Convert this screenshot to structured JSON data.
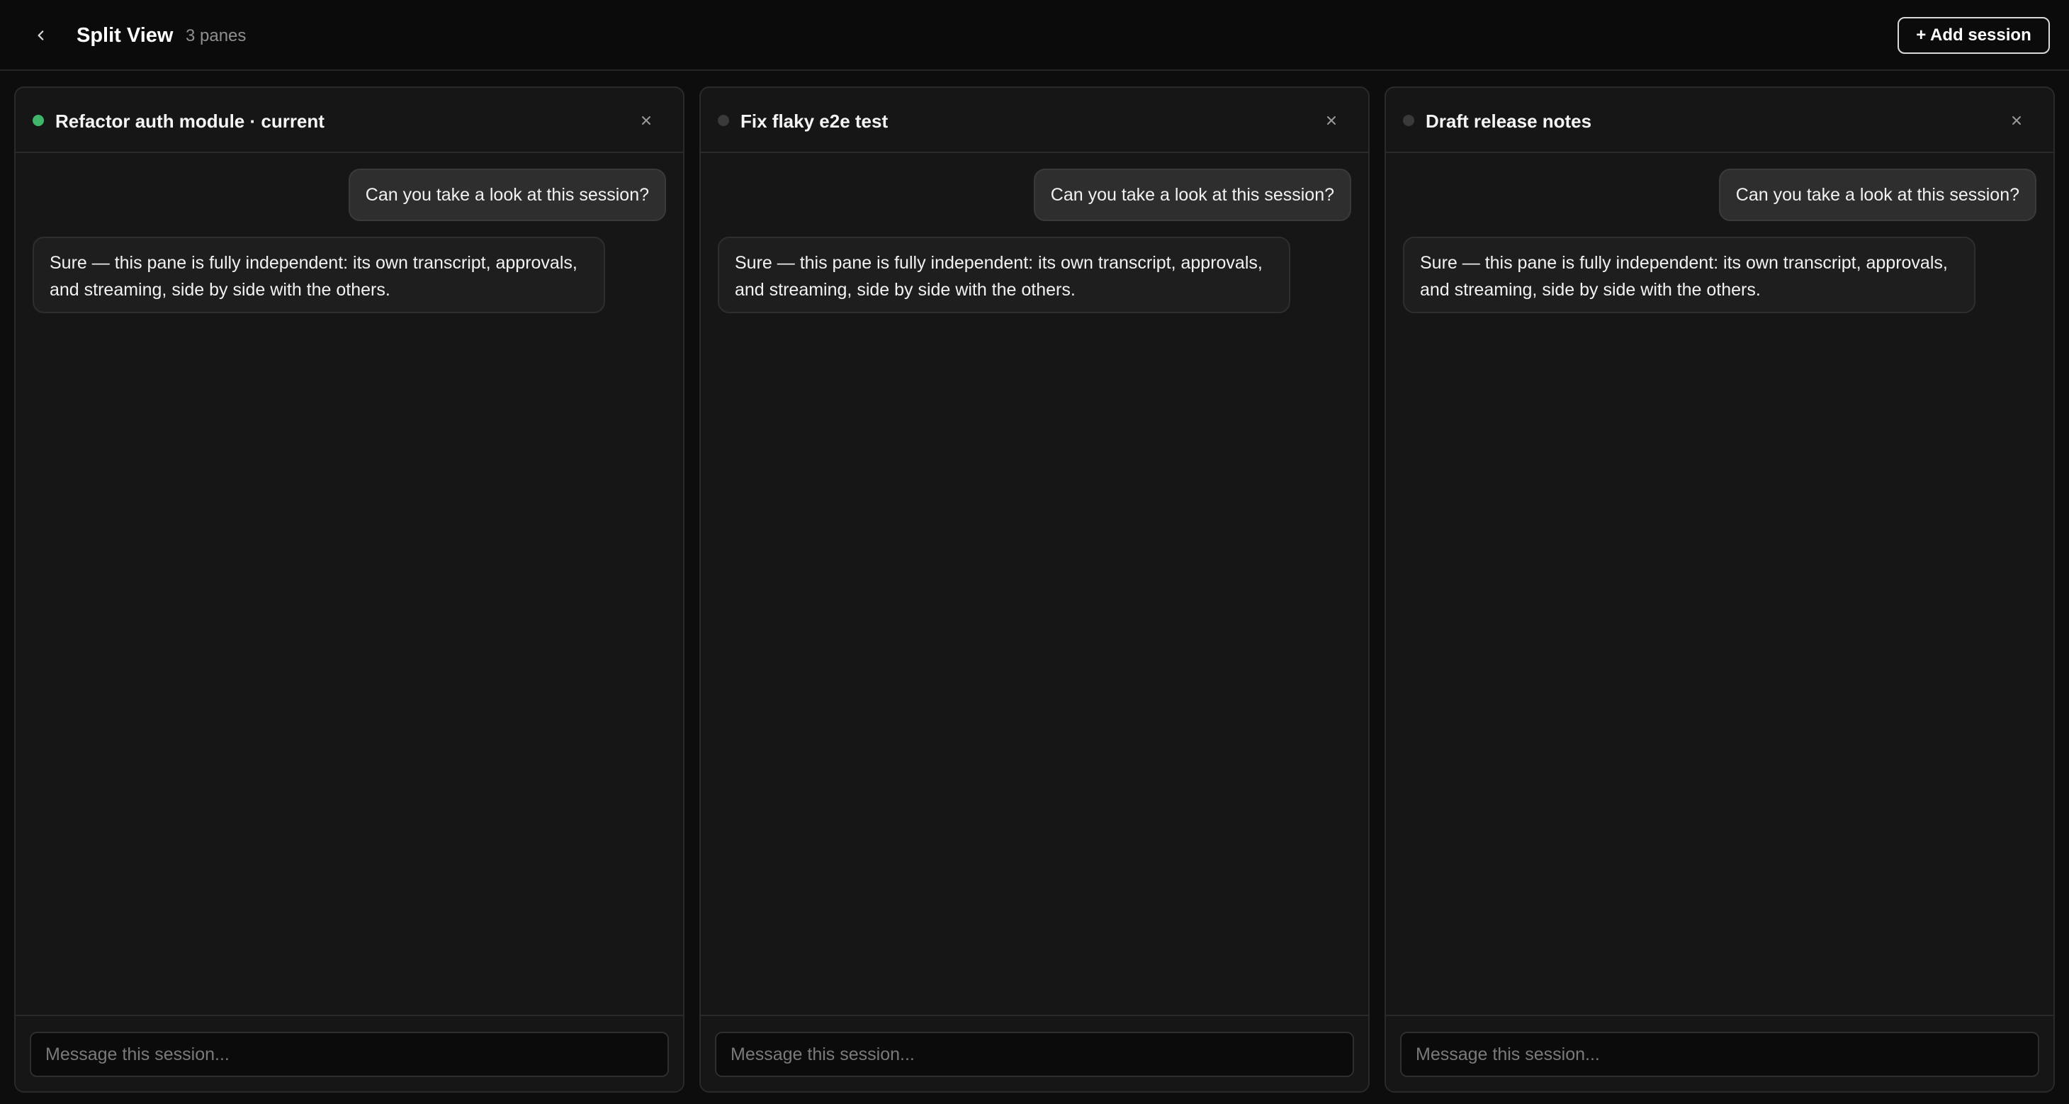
{
  "header": {
    "title": "Split View",
    "pane_count": "3 panes",
    "add_session_label": "+ Add session",
    "back_icon": "chevron-left-icon"
  },
  "panes": [
    {
      "title": "Refactor auth module · current",
      "status": "active",
      "status_color": "#3fb56b",
      "user_message": "Can you take a look at this session?",
      "assistant_message": "Sure — this pane is fully independent: its own transcript, approvals, and streaming, side by side with the others.",
      "composer_placeholder": "Message this session..."
    },
    {
      "title": "Fix flaky e2e test",
      "status": "idle",
      "status_color": "#3a3a3a",
      "user_message": "Can you take a look at this session?",
      "assistant_message": "Sure — this pane is fully independent: its own transcript, approvals, and streaming, side by side with the others.",
      "composer_placeholder": "Message this session..."
    },
    {
      "title": "Draft release notes",
      "status": "idle",
      "status_color": "#3a3a3a",
      "user_message": "Can you take a look at this session?",
      "assistant_message": "Sure — this pane is fully independent: its own transcript, approvals, and streaming, side by side with the others.",
      "composer_placeholder": "Message this session..."
    }
  ],
  "colors": {
    "background": "#0d0d0d",
    "pane_background": "#161616",
    "border": "#2a2a2a",
    "active_status": "#3fb56b"
  }
}
